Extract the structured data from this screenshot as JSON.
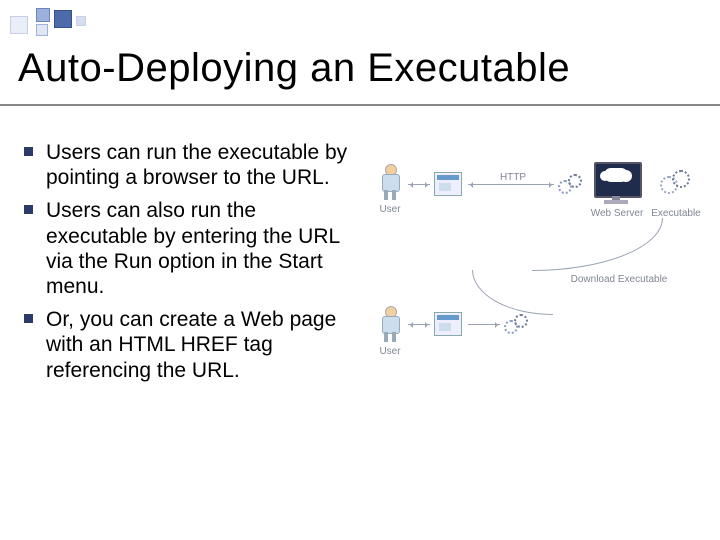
{
  "title": "Auto-Deploying an Executable",
  "bullets": [
    "Users can run the executable by pointing a browser to the URL.",
    "Users can also run the executable by entering the URL via the Run option in the Start menu.",
    "Or, you can create a Web page with an HTML HREF tag referencing the URL."
  ],
  "diagram": {
    "labels": {
      "user_top": "User",
      "user_bot": "User",
      "http": "HTTP",
      "web_server": "Web Server",
      "executable": "Executable",
      "download": "Download Executable"
    }
  }
}
